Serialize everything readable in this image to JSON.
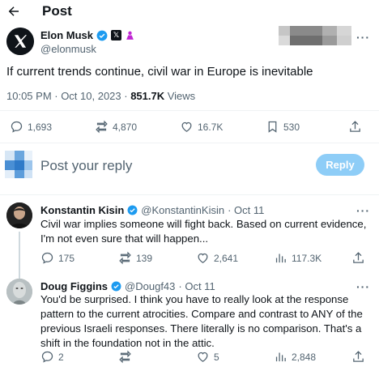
{
  "header": {
    "title": "Post",
    "back_icon": "arrow-left-icon"
  },
  "post": {
    "author_name": "Elon Musk",
    "author_handle": "@elonmusk",
    "text": "If current trends continue, civil war in Europe is inevitable",
    "time": "10:05 PM · Oct 10, 2023 · ",
    "views_count": "851.7K",
    "views_label": " Views",
    "replies": "1,693",
    "reposts": "4,870",
    "likes": "16.7K",
    "bookmarks": "530"
  },
  "reply_box": {
    "placeholder": "Post your reply",
    "button_label": "Reply"
  },
  "replies": [
    {
      "author_name": "Konstantin Kisin",
      "author_handle": "@KonstantinKisin",
      "date": "· Oct 11",
      "text": "Civil war implies someone will fight back. Based on current evidence, I'm not even sure that will happen...",
      "replies": "175",
      "reposts": "139",
      "likes": "2,641",
      "views": "117.3K"
    },
    {
      "author_name": "Doug Figgins",
      "author_handle": "@Dougf43",
      "date": "· Oct 11",
      "text": "You'd be surprised. I think you have to really look at the response pattern to the current atrocities. Compare and contrast to ANY of the previous Israeli responses. There literally is no comparison. That's a shift in the foundation not in the attic.",
      "replies": "2",
      "reposts": "",
      "likes": "5",
      "views": "2,848"
    }
  ],
  "colors": {
    "accent": "#1d9bf0",
    "reply_button_disabled": "#8ecdf7",
    "muted": "#536471",
    "badge_pink": "#c026d3"
  }
}
